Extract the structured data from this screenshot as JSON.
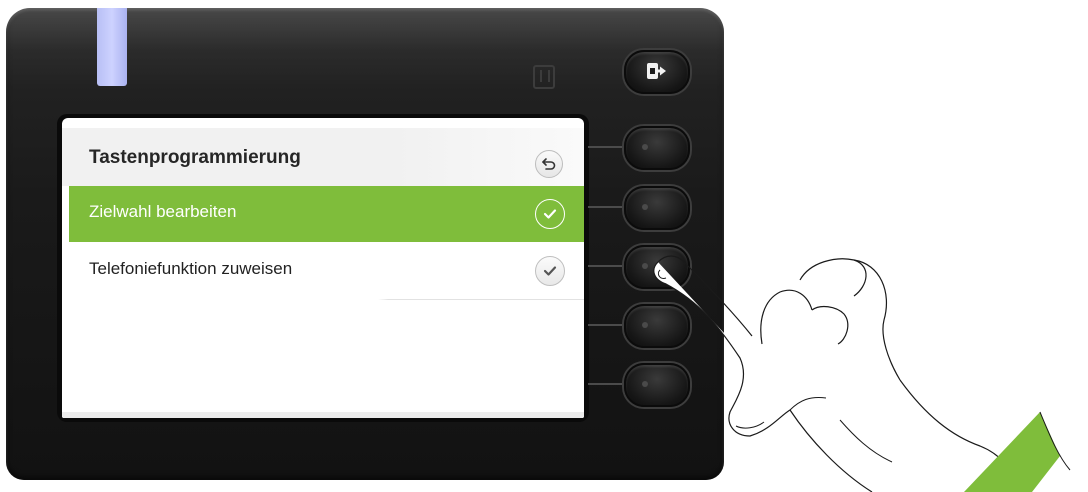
{
  "screen": {
    "title": "Tastenprogrammierung",
    "rows": [
      {
        "label": "Zielwahl bearbeiten",
        "selected": true
      },
      {
        "label": "Telefoniefunktion zuweisen",
        "selected": false
      }
    ]
  },
  "icons": {
    "back": "back-arrow-icon",
    "confirm": "checkmark-icon",
    "leave": "leave-arrow-icon",
    "nfc": "nfc-icon"
  },
  "colors": {
    "accent": "#7fbd3b",
    "led": "#c4c9fb",
    "device": "#1a1a1a"
  }
}
